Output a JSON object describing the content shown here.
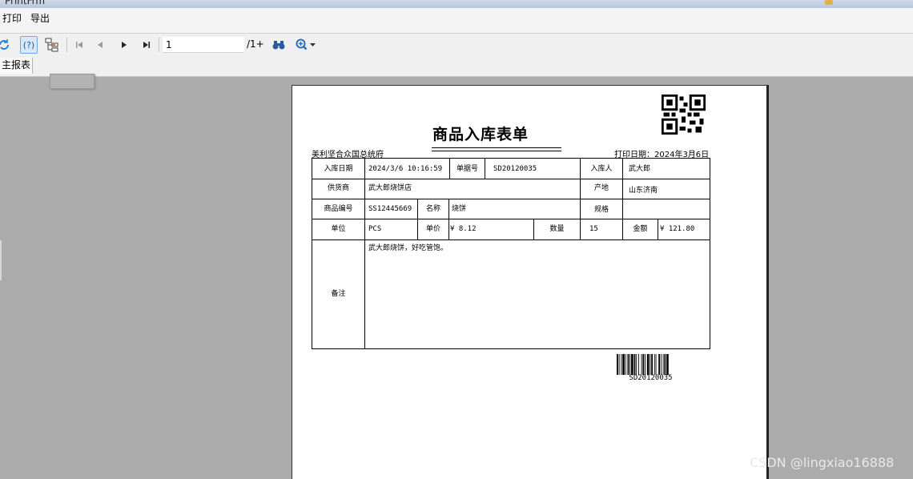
{
  "window": {
    "title": "PrintFrm"
  },
  "menu": {
    "print": "打印",
    "export": "导出"
  },
  "toolbar": {
    "page_value": "1",
    "page_total": "/1+"
  },
  "tabs": {
    "main_report": "主报表"
  },
  "report": {
    "title": "商品入库表单",
    "company": "美利坚合众国总统府",
    "print_date": "打印日期：2024年3月6日",
    "labels": {
      "in_date": "入库日期",
      "order_no": "单据号",
      "receiver": "入库人",
      "supplier": "供货商",
      "origin": "产地",
      "item_code": "商品编号",
      "name": "名称",
      "spec": "规格",
      "unit": "单位",
      "unit_price": "单价",
      "quantity": "数量",
      "amount": "金额",
      "remark": "备注"
    },
    "values": {
      "in_date": "2024/3/6 10:16:59",
      "order_no": "SD20120035",
      "receiver": "武大郎",
      "supplier": "武大郎烧饼店",
      "origin": "山东济南",
      "item_code": "SS12445669",
      "name": "烧饼",
      "spec": "",
      "unit": "PCS",
      "unit_price": "¥ 8.12",
      "quantity": "15",
      "amount": "¥ 121.80",
      "remark": "武大郎烧饼，好吃管饱。"
    },
    "barcode_text": "SD20120035"
  },
  "watermark": "CSDN @lingxiao16888",
  "icons": {
    "refresh": "refresh-icon",
    "help": "help-icon",
    "tree": "tree-icon",
    "first": "first-page-icon",
    "prev": "prev-page-icon",
    "next": "next-page-icon",
    "last": "last-page-icon",
    "find": "binoculars-icon",
    "zoom": "zoom-in-icon"
  }
}
